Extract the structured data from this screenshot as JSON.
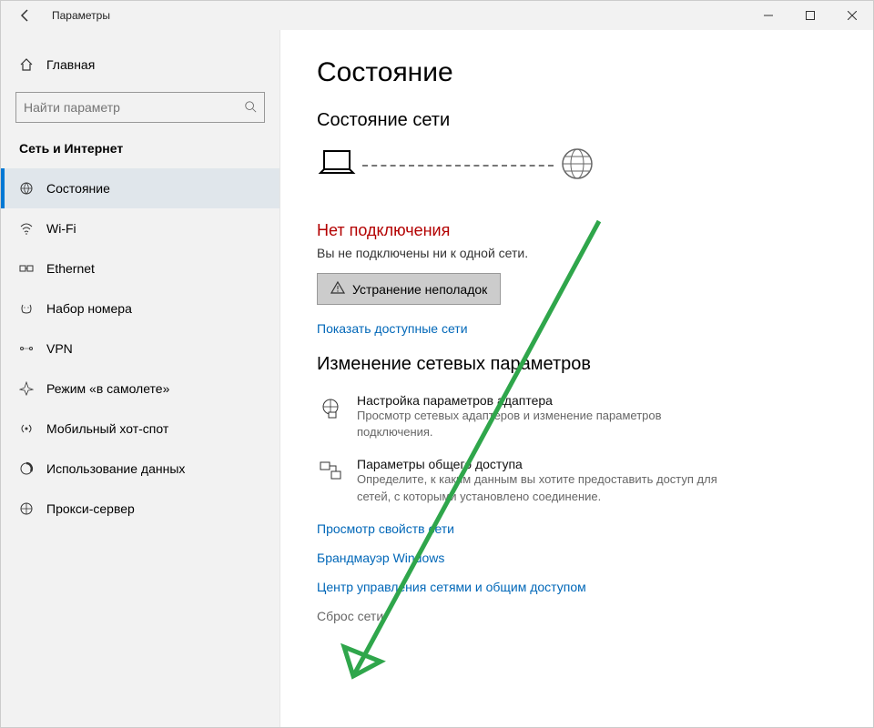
{
  "titlebar": {
    "title": "Параметры"
  },
  "sidebar": {
    "home": "Главная",
    "search_placeholder": "Найти параметр",
    "section": "Сеть и Интернет",
    "items": [
      {
        "label": "Состояние"
      },
      {
        "label": "Wi-Fi"
      },
      {
        "label": "Ethernet"
      },
      {
        "label": "Набор номера"
      },
      {
        "label": "VPN"
      },
      {
        "label": "Режим «в самолете»"
      },
      {
        "label": "Мобильный хот-спот"
      },
      {
        "label": "Использование данных"
      },
      {
        "label": "Прокси-сервер"
      }
    ]
  },
  "main": {
    "heading": "Состояние",
    "subheading": "Состояние сети",
    "status_title": "Нет подключения",
    "status_sub": "Вы не подключены ни к одной сети.",
    "troubleshoot": "Устранение неполадок",
    "show_networks": "Показать доступные сети",
    "change_heading": "Изменение сетевых параметров",
    "adapter_title": "Настройка параметров адаптера",
    "adapter_desc": "Просмотр сетевых адаптеров и изменение параметров подключения.",
    "sharing_title": "Параметры общего доступа",
    "sharing_desc": "Определите, к каким данным вы хотите предоставить доступ для сетей, с которыми установлено соединение.",
    "link_props": "Просмотр свойств сети",
    "link_firewall": "Брандмауэр Windows",
    "link_center": "Центр управления сетями и общим доступом",
    "reset": "Сброс сети"
  },
  "annotation": {
    "type": "arrow",
    "color": "#2fa64b"
  }
}
